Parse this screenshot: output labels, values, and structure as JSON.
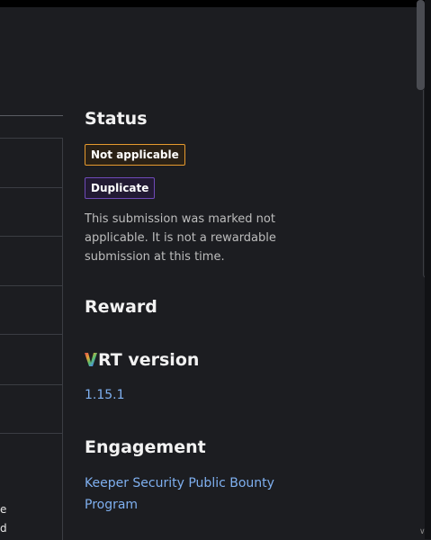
{
  "status": {
    "heading": "Status",
    "badges": [
      "Not applicable",
      "Duplicate"
    ],
    "description": "This submission was marked not applicable. It is not a rewardable submission at this time."
  },
  "reward": {
    "heading": "Reward"
  },
  "vrt": {
    "heading": "VRT version",
    "logo_letter": "V",
    "heading_rest": "RT version",
    "version": "1.15.1"
  },
  "engagement": {
    "heading": "Engagement",
    "program_link": "Keeper Security Public Bounty Program"
  },
  "left_fragments": [
    "e",
    "d"
  ],
  "colors": {
    "background": "#1c1d21",
    "link": "#7fb0f0",
    "not_applicable_border": "#e69a2e",
    "duplicate_border": "#6f4ab8"
  }
}
